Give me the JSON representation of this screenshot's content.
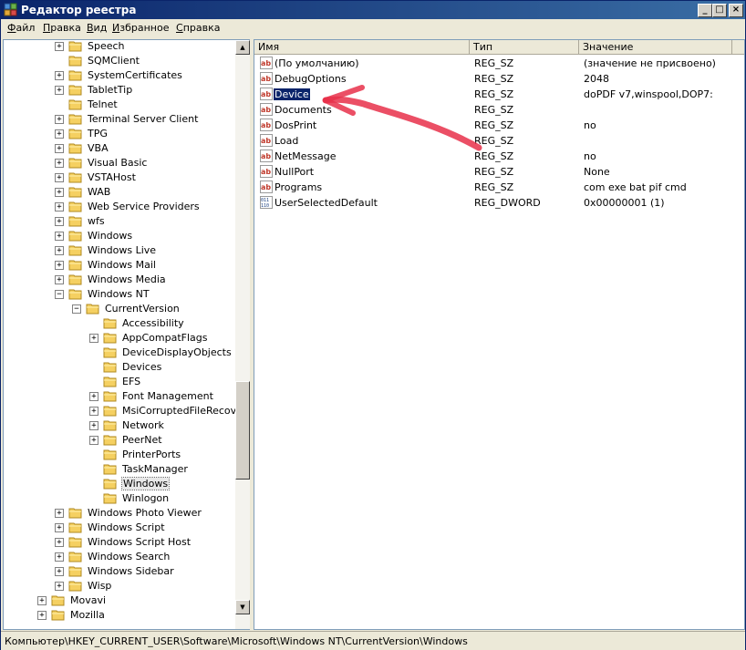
{
  "window": {
    "title": "Редактор реестра",
    "controls": {
      "minimize": "_",
      "maximize": "□",
      "close": "×"
    }
  },
  "menu": {
    "items": [
      {
        "underline": "Ф",
        "rest": "айл"
      },
      {
        "underline": "П",
        "rest": "равка"
      },
      {
        "underline": "В",
        "rest": "ид"
      },
      {
        "underline": "И",
        "rest": "збранное"
      },
      {
        "underline": "С",
        "rest": "правка"
      }
    ]
  },
  "tree": {
    "items": [
      {
        "label": "Speech",
        "level": 2,
        "expander": "+"
      },
      {
        "label": "SQMClient",
        "level": 2,
        "expander": ""
      },
      {
        "label": "SystemCertificates",
        "level": 2,
        "expander": "+"
      },
      {
        "label": "TabletTip",
        "level": 2,
        "expander": "+"
      },
      {
        "label": "Telnet",
        "level": 2,
        "expander": ""
      },
      {
        "label": "Terminal Server Client",
        "level": 2,
        "expander": "+"
      },
      {
        "label": "TPG",
        "level": 2,
        "expander": "+"
      },
      {
        "label": "VBA",
        "level": 2,
        "expander": "+"
      },
      {
        "label": "Visual Basic",
        "level": 2,
        "expander": "+"
      },
      {
        "label": "VSTAHost",
        "level": 2,
        "expander": "+"
      },
      {
        "label": "WAB",
        "level": 2,
        "expander": "+"
      },
      {
        "label": "Web Service Providers",
        "level": 2,
        "expander": "+"
      },
      {
        "label": "wfs",
        "level": 2,
        "expander": "+"
      },
      {
        "label": "Windows",
        "level": 2,
        "expander": "+"
      },
      {
        "label": "Windows Live",
        "level": 2,
        "expander": "+"
      },
      {
        "label": "Windows Mail",
        "level": 2,
        "expander": "+"
      },
      {
        "label": "Windows Media",
        "level": 2,
        "expander": "+"
      },
      {
        "label": "Windows NT",
        "level": 2,
        "expander": "−"
      },
      {
        "label": "CurrentVersion",
        "level": 3,
        "expander": "−"
      },
      {
        "label": "Accessibility",
        "level": 4,
        "expander": ""
      },
      {
        "label": "AppCompatFlags",
        "level": 4,
        "expander": "+"
      },
      {
        "label": "DeviceDisplayObjects",
        "level": 4,
        "expander": ""
      },
      {
        "label": "Devices",
        "level": 4,
        "expander": ""
      },
      {
        "label": "EFS",
        "level": 4,
        "expander": ""
      },
      {
        "label": "Font Management",
        "level": 4,
        "expander": "+"
      },
      {
        "label": "MsiCorruptedFileRecovery",
        "level": 4,
        "expander": "+"
      },
      {
        "label": "Network",
        "level": 4,
        "expander": "+"
      },
      {
        "label": "PeerNet",
        "level": 4,
        "expander": "+"
      },
      {
        "label": "PrinterPorts",
        "level": 4,
        "expander": ""
      },
      {
        "label": "TaskManager",
        "level": 4,
        "expander": ""
      },
      {
        "label": "Windows",
        "level": 4,
        "expander": "",
        "selected": true
      },
      {
        "label": "Winlogon",
        "level": 4,
        "expander": ""
      },
      {
        "label": "Windows Photo Viewer",
        "level": 2,
        "expander": "+"
      },
      {
        "label": "Windows Script",
        "level": 2,
        "expander": "+"
      },
      {
        "label": "Windows Script Host",
        "level": 2,
        "expander": "+"
      },
      {
        "label": "Windows Search",
        "level": 2,
        "expander": "+"
      },
      {
        "label": "Windows Sidebar",
        "level": 2,
        "expander": "+"
      },
      {
        "label": "Wisp",
        "level": 2,
        "expander": "+"
      },
      {
        "label": "Movavi",
        "level": 1,
        "expander": "+"
      },
      {
        "label": "Mozilla",
        "level": 1,
        "expander": "+"
      }
    ]
  },
  "values": {
    "columns": [
      "Имя",
      "Тип",
      "Значение"
    ],
    "rows": [
      {
        "icon": "string",
        "name": "(По умолчанию)",
        "type": "REG_SZ",
        "data": "(значение не присвоено)"
      },
      {
        "icon": "string",
        "name": "DebugOptions",
        "type": "REG_SZ",
        "data": "2048"
      },
      {
        "icon": "string",
        "name": "Device",
        "type": "REG_SZ",
        "data": "doPDF v7,winspool,DOP7:",
        "selected": true
      },
      {
        "icon": "string",
        "name": "Documents",
        "type": "REG_SZ",
        "data": ""
      },
      {
        "icon": "string",
        "name": "DosPrint",
        "type": "REG_SZ",
        "data": "no"
      },
      {
        "icon": "string",
        "name": "Load",
        "type": "REG_SZ",
        "data": ""
      },
      {
        "icon": "string",
        "name": "NetMessage",
        "type": "REG_SZ",
        "data": "no"
      },
      {
        "icon": "string",
        "name": "NullPort",
        "type": "REG_SZ",
        "data": "None"
      },
      {
        "icon": "string",
        "name": "Programs",
        "type": "REG_SZ",
        "data": "com exe bat pif cmd"
      },
      {
        "icon": "binary",
        "name": "UserSelectedDefault",
        "type": "REG_DWORD",
        "data": "0x00000001 (1)"
      }
    ]
  },
  "annotation": {
    "color": "#e8304a",
    "shape": "hand-drawn arrow pointing to Device"
  },
  "status": {
    "path": "Компьютер\\HKEY_CURRENT_USER\\Software\\Microsoft\\Windows NT\\CurrentVersion\\Windows"
  },
  "colors": {
    "titlebar": "#0a246a",
    "selection": "#0a246a",
    "folder": "#f5d061"
  }
}
